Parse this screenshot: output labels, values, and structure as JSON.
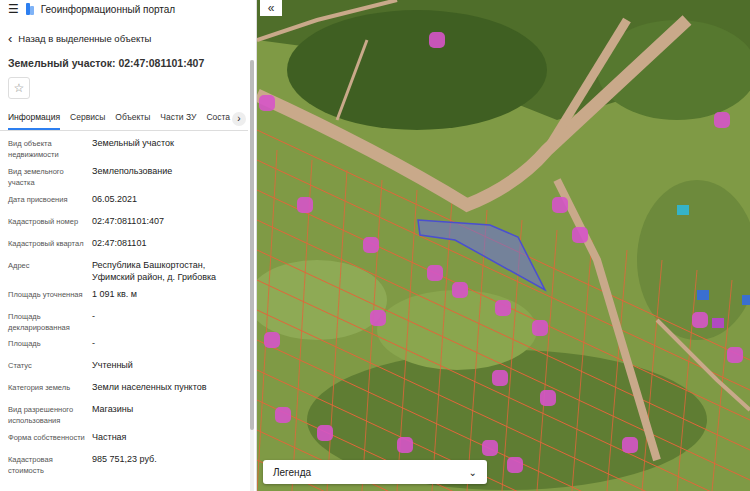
{
  "header": {
    "menu_icon": "☰",
    "title": "Геоинформационный портал"
  },
  "back_link": {
    "arrow": "‹",
    "label": "Назад в выделенные объекты"
  },
  "object_title": "Земельный участок: 02:47:081101:407",
  "favorite": {
    "icon": "☆",
    "on": false
  },
  "tabs": [
    {
      "label": "Информация",
      "selected": true
    },
    {
      "label": "Сервисы",
      "selected": false
    },
    {
      "label": "Объекты",
      "selected": false
    },
    {
      "label": "Части ЗУ",
      "selected": false
    },
    {
      "label": "Соста",
      "selected": false
    }
  ],
  "tabs_next": "›",
  "fields": [
    {
      "label": "Вид объекта недвижимости",
      "value": "Земельный участок"
    },
    {
      "label": "Вид земельного участка",
      "value": "Землепользование"
    },
    {
      "label": "Дата присвоения",
      "value": "06.05.2021"
    },
    {
      "label": "Кадастровый номер",
      "value": "02:47:081101:407"
    },
    {
      "label": "Кадастровый квартал",
      "value": "02:47:081101"
    },
    {
      "label": "Адрес",
      "value": "Республика Башкортостан, Уфимский район, д. Грибовка"
    },
    {
      "label": "Площадь уточненная",
      "value": "1 091 кв. м"
    },
    {
      "label": "Площадь декларированная",
      "value": "-"
    },
    {
      "label": "Площадь",
      "value": "-"
    },
    {
      "label": "Статус",
      "value": "Учтенный"
    },
    {
      "label": "Категория земель",
      "value": "Земли населенных пунктов"
    },
    {
      "label": "Вид разрешенного использования",
      "value": "Магазины"
    },
    {
      "label": "Форма собственности",
      "value": "Частная"
    },
    {
      "label": "Кадастровая стоимость",
      "value": "985 751,23 руб."
    }
  ],
  "map": {
    "collapse_button": "«",
    "selected_parcel_highlighted": true,
    "legend": {
      "label": "Легенда",
      "expanded": false,
      "arrow": "⌄"
    }
  }
}
